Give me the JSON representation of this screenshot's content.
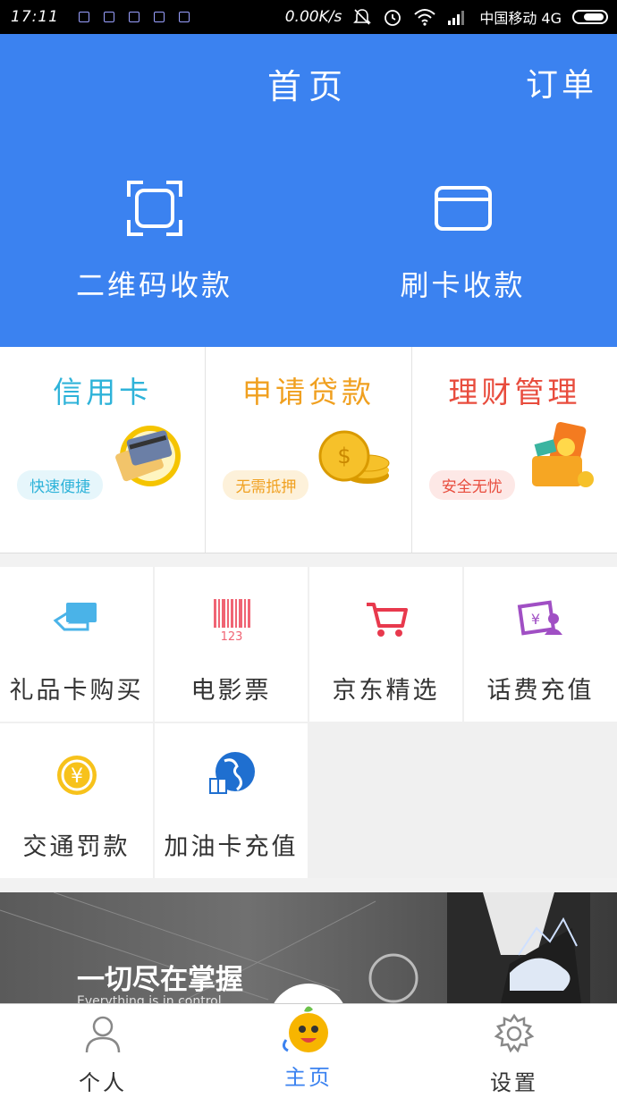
{
  "status_bar": {
    "time": "17:11",
    "net_speed": "0.00K/s",
    "carrier": "中国移动 4G"
  },
  "header": {
    "title": "首页",
    "order_link": "订单",
    "actions": [
      {
        "label": "二维码收款",
        "icon": "qr-scan-icon"
      },
      {
        "label": "刷卡收款",
        "icon": "card-icon"
      }
    ]
  },
  "promos": [
    {
      "title": "信用卡",
      "badge": "快速便捷",
      "color": "#2eb3d9",
      "badge_bg": "#e6f6fb",
      "icon": "credit-card-icon"
    },
    {
      "title": "申请贷款",
      "badge": "无需抵押",
      "color": "#f0a020",
      "badge_bg": "#fdf1da",
      "icon": "gold-coins-icon"
    },
    {
      "title": "理财管理",
      "badge": "安全无忧",
      "color": "#e84c3d",
      "badge_bg": "#fde8e6",
      "icon": "wallet-phone-icon"
    }
  ],
  "services": [
    {
      "label": "礼品卡购买",
      "icon": "gift-card-icon"
    },
    {
      "label": "电影票",
      "icon": "barcode-ticket-icon"
    },
    {
      "label": "京东精选",
      "icon": "shopping-cart-icon"
    },
    {
      "label": "话费充值",
      "icon": "phone-recharge-icon"
    },
    {
      "label": "交通罚款",
      "icon": "yuan-coin-icon"
    },
    {
      "label": "加油卡充值",
      "icon": "globe-gift-icon"
    }
  ],
  "banner": {
    "headline": "一切尽在掌握",
    "subline": "Everything is in control"
  },
  "tabbar": {
    "tabs": [
      {
        "label": "个人",
        "icon": "person-icon"
      },
      {
        "label": "主页",
        "icon": "mascot-icon"
      },
      {
        "label": "设置",
        "icon": "gear-icon"
      }
    ],
    "active_color": "#3b82f0"
  },
  "colors": {
    "primary": "#3b82f0"
  }
}
